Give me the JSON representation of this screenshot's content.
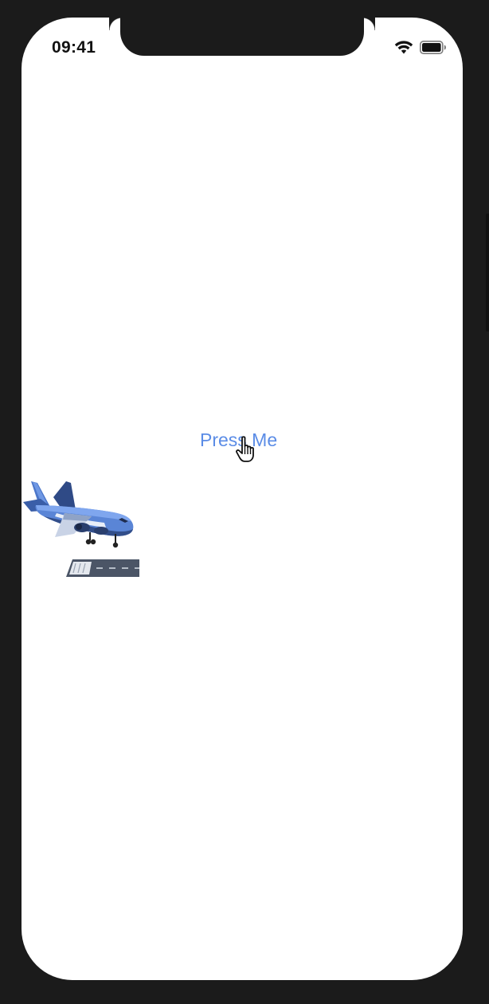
{
  "status_bar": {
    "time": "09:41",
    "icons": [
      "wifi-icon",
      "battery-icon"
    ]
  },
  "main": {
    "button_label": "Press Me",
    "button_color": "#5b8ce6"
  },
  "illustration": {
    "icons": [
      "airplane-landing-icon",
      "runway-icon",
      "pointer-hand-cursor-icon"
    ]
  }
}
